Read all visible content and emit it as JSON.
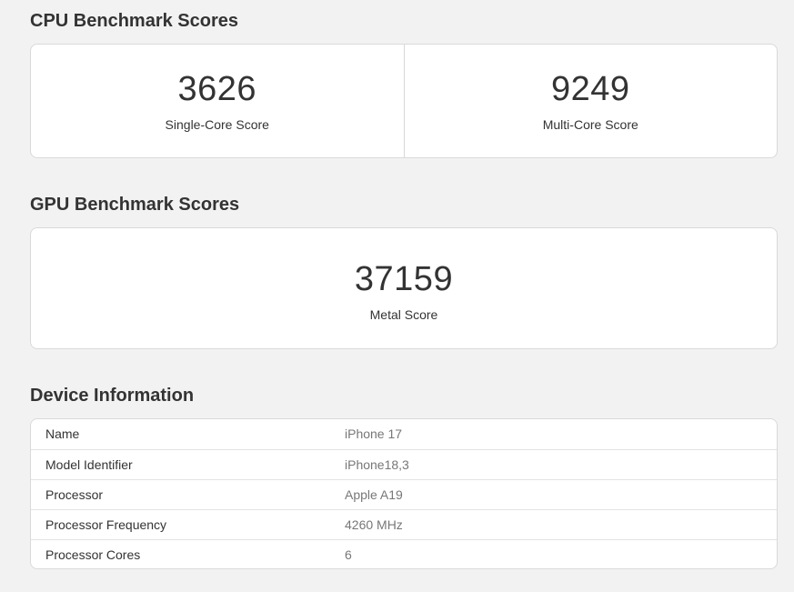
{
  "cpu": {
    "title": "CPU Benchmark Scores",
    "scores": [
      {
        "value": "3626",
        "label": "Single-Core Score"
      },
      {
        "value": "9249",
        "label": "Multi-Core Score"
      }
    ]
  },
  "gpu": {
    "title": "GPU Benchmark Scores",
    "scores": [
      {
        "value": "37159",
        "label": "Metal Score"
      }
    ]
  },
  "device": {
    "title": "Device Information",
    "rows": [
      {
        "key": "Name",
        "value": "iPhone 17"
      },
      {
        "key": "Model Identifier",
        "value": "iPhone18,3"
      },
      {
        "key": "Processor",
        "value": "Apple A19"
      },
      {
        "key": "Processor Frequency",
        "value": "4260 MHz"
      },
      {
        "key": "Processor Cores",
        "value": "6"
      }
    ]
  },
  "colors": {
    "background": "#f2f2f2",
    "card": "#ffffff",
    "border": "#d9d9d9",
    "text": "#333333",
    "muted_text": "#777777"
  }
}
